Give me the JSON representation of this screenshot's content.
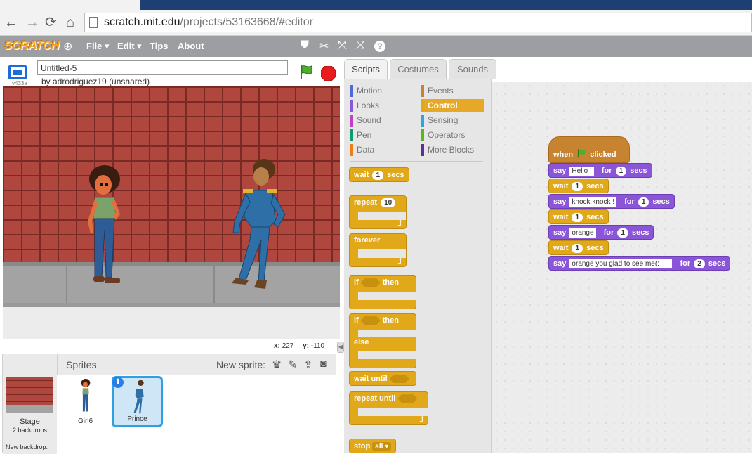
{
  "browser": {
    "url_host": "scratch.mit.edu",
    "url_path": "/projects/53163668/#editor"
  },
  "menu": {
    "logo": "SCRATCH",
    "file": "File ▾",
    "edit": "Edit ▾",
    "tips": "Tips",
    "about": "About"
  },
  "project": {
    "title": "Untitled-5",
    "byline": "by adrodriguez19 (unshared)",
    "version": "v433a"
  },
  "stage_coords": {
    "x_label": "x:",
    "x": "227",
    "y_label": "y:",
    "y": "-110"
  },
  "sprites": {
    "header": "Sprites",
    "new_sprite": "New sprite:",
    "stage_label": "Stage",
    "stage_backdrops": "2 backdrops",
    "new_backdrop": "New backdrop:",
    "list": [
      {
        "name": "Girl6"
      },
      {
        "name": "Prince"
      }
    ]
  },
  "tabs": [
    "Scripts",
    "Costumes",
    "Sounds"
  ],
  "categories": {
    "left": [
      {
        "label": "Motion",
        "color": "#4a6cd4"
      },
      {
        "label": "Looks",
        "color": "#8a55d7"
      },
      {
        "label": "Sound",
        "color": "#bb42c3"
      },
      {
        "label": "Pen",
        "color": "#0e9a6c"
      },
      {
        "label": "Data",
        "color": "#ee7d16"
      }
    ],
    "right": [
      {
        "label": "Events",
        "color": "#c88330"
      },
      {
        "label": "Control",
        "color": "#e1a91a"
      },
      {
        "label": "Sensing",
        "color": "#2ca5e2"
      },
      {
        "label": "Operators",
        "color": "#5cb712"
      },
      {
        "label": "More Blocks",
        "color": "#632d99"
      }
    ]
  },
  "palette": {
    "wait_pre": "wait",
    "wait_num": "1",
    "wait_post": "secs",
    "repeat": "repeat",
    "repeat_num": "10",
    "forever": "forever",
    "if": "if",
    "then": "then",
    "else": "else",
    "wait_until": "wait until",
    "repeat_until": "repeat until",
    "stop": "stop",
    "stop_opt": "all ▾"
  },
  "script": {
    "hat_when": "when",
    "hat_clicked": "clicked",
    "blocks": [
      {
        "kind": "say",
        "pre": "say",
        "text": "Hello !",
        "mid": "for",
        "num": "1",
        "post": "secs"
      },
      {
        "kind": "wait",
        "pre": "wait",
        "num": "1",
        "post": "secs"
      },
      {
        "kind": "say",
        "pre": "say",
        "text": "knock knock !",
        "mid": "for",
        "num": "1",
        "post": "secs"
      },
      {
        "kind": "wait",
        "pre": "wait",
        "num": "1",
        "post": "secs"
      },
      {
        "kind": "say",
        "pre": "say",
        "text": "orange",
        "mid": "for",
        "num": "1",
        "post": "secs"
      },
      {
        "kind": "wait",
        "pre": "wait",
        "num": "1",
        "post": "secs"
      },
      {
        "kind": "say",
        "pre": "say",
        "text": "orange you glad to see me(:",
        "mid": "for",
        "num": "2",
        "post": "secs"
      }
    ]
  },
  "colors": {
    "control": "#e1a91a",
    "looks": "#8a55d7",
    "flag": "#3c9a2a",
    "stop": "#e81c1c"
  }
}
